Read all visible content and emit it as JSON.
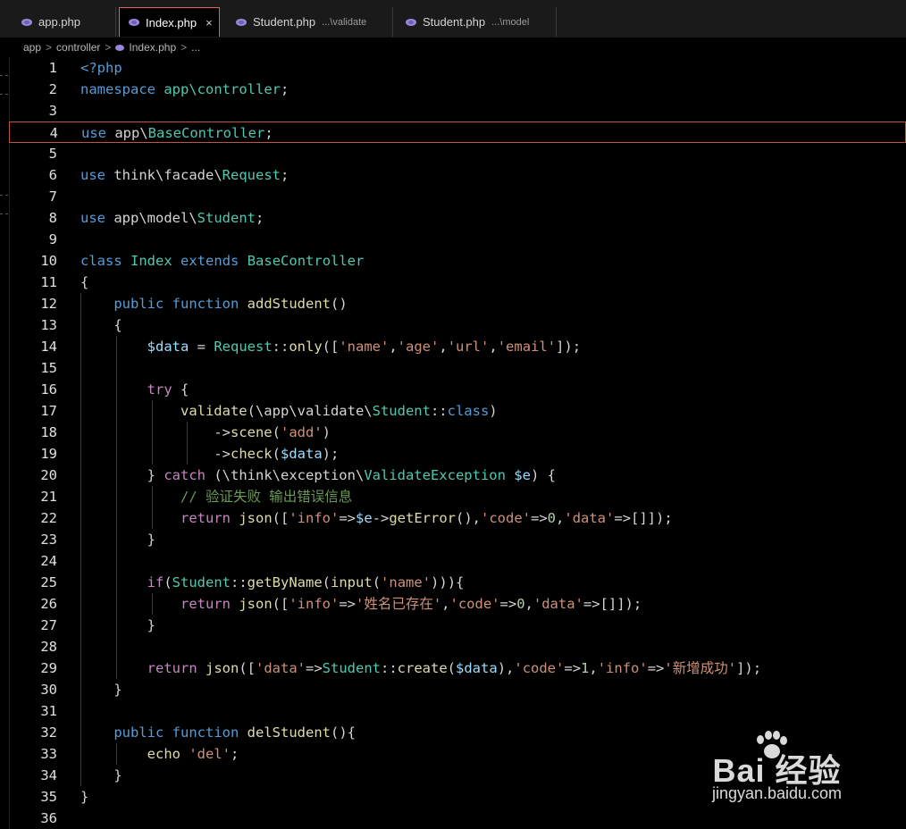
{
  "tabs": [
    {
      "label": "app.php",
      "desc": "",
      "active": false
    },
    {
      "label": "Index.php",
      "desc": "",
      "active": true
    },
    {
      "label": "Student.php",
      "desc": "...\\validate",
      "active": false
    },
    {
      "label": "Student.php",
      "desc": "...\\model",
      "active": false
    }
  ],
  "close_glyph": "×",
  "breadcrumb": {
    "items": [
      "app",
      "controller",
      "Index.php",
      "..."
    ],
    "separator": ">"
  },
  "editor": {
    "current_line": 4,
    "lines": [
      [
        [
          "kw",
          "<?php"
        ]
      ],
      [
        [
          "kw",
          "namespace"
        ],
        [
          "pl",
          " "
        ],
        [
          "cls",
          "app\\controller"
        ],
        [
          "pl",
          ";"
        ]
      ],
      [],
      [
        [
          "kw",
          "use"
        ],
        [
          "pl",
          " app\\"
        ],
        [
          "cls",
          "BaseController"
        ],
        [
          "pl",
          ";"
        ]
      ],
      [],
      [
        [
          "kw",
          "use"
        ],
        [
          "pl",
          " think\\facade\\"
        ],
        [
          "cls",
          "Request"
        ],
        [
          "pl",
          ";"
        ]
      ],
      [],
      [
        [
          "kw",
          "use"
        ],
        [
          "pl",
          " app\\model\\"
        ],
        [
          "cls",
          "Student"
        ],
        [
          "pl",
          ";"
        ]
      ],
      [],
      [
        [
          "kw",
          "class"
        ],
        [
          "pl",
          " "
        ],
        [
          "cls",
          "Index"
        ],
        [
          "pl",
          " "
        ],
        [
          "kw",
          "extends"
        ],
        [
          "pl",
          " "
        ],
        [
          "cls",
          "BaseController"
        ]
      ],
      [
        [
          "pl",
          "{"
        ]
      ],
      [
        [
          "pl",
          "    "
        ],
        [
          "kw",
          "public"
        ],
        [
          "pl",
          " "
        ],
        [
          "kw",
          "function"
        ],
        [
          "pl",
          " "
        ],
        [
          "fn",
          "addStudent"
        ],
        [
          "pl",
          "()"
        ]
      ],
      [
        [
          "pl",
          "    {"
        ]
      ],
      [
        [
          "pl",
          "        "
        ],
        [
          "var",
          "$data"
        ],
        [
          "pl",
          " = "
        ],
        [
          "cls",
          "Request"
        ],
        [
          "pl",
          "::"
        ],
        [
          "fn",
          "only"
        ],
        [
          "pl",
          "(["
        ],
        [
          "str",
          "'name'"
        ],
        [
          "pl",
          ","
        ],
        [
          "str",
          "'age'"
        ],
        [
          "pl",
          ","
        ],
        [
          "str",
          "'url'"
        ],
        [
          "pl",
          ","
        ],
        [
          "str",
          "'email'"
        ],
        [
          "pl",
          "]);"
        ]
      ],
      [],
      [
        [
          "pl",
          "        "
        ],
        [
          "ctl",
          "try"
        ],
        [
          "pl",
          " {"
        ]
      ],
      [
        [
          "pl",
          "            "
        ],
        [
          "fn",
          "validate"
        ],
        [
          "pl",
          "(\\app\\validate\\"
        ],
        [
          "cls",
          "Student"
        ],
        [
          "pl",
          "::"
        ],
        [
          "kw",
          "class"
        ],
        [
          "pl",
          ")"
        ]
      ],
      [
        [
          "pl",
          "                ->"
        ],
        [
          "fn",
          "scene"
        ],
        [
          "pl",
          "("
        ],
        [
          "str",
          "'add'"
        ],
        [
          "pl",
          ")"
        ]
      ],
      [
        [
          "pl",
          "                ->"
        ],
        [
          "fn",
          "check"
        ],
        [
          "pl",
          "("
        ],
        [
          "var",
          "$data"
        ],
        [
          "pl",
          ");"
        ]
      ],
      [
        [
          "pl",
          "        } "
        ],
        [
          "ctl",
          "catch"
        ],
        [
          "pl",
          " (\\think\\exception\\"
        ],
        [
          "cls",
          "ValidateException"
        ],
        [
          "pl",
          " "
        ],
        [
          "var",
          "$e"
        ],
        [
          "pl",
          ") {"
        ]
      ],
      [
        [
          "pl",
          "            "
        ],
        [
          "cmt",
          "// 验证失败 输出错误信息"
        ]
      ],
      [
        [
          "pl",
          "            "
        ],
        [
          "ctl",
          "return"
        ],
        [
          "pl",
          " "
        ],
        [
          "fn",
          "json"
        ],
        [
          "pl",
          "(["
        ],
        [
          "str",
          "'info'"
        ],
        [
          "pl",
          "=>"
        ],
        [
          "var",
          "$e"
        ],
        [
          "pl",
          "->"
        ],
        [
          "fn",
          "getError"
        ],
        [
          "pl",
          "(),"
        ],
        [
          "str",
          "'code'"
        ],
        [
          "pl",
          "=>"
        ],
        [
          "num",
          "0"
        ],
        [
          "pl",
          ","
        ],
        [
          "str",
          "'data'"
        ],
        [
          "pl",
          "=>[]]);"
        ]
      ],
      [
        [
          "pl",
          "        }"
        ]
      ],
      [],
      [
        [
          "pl",
          "        "
        ],
        [
          "ctl",
          "if"
        ],
        [
          "pl",
          "("
        ],
        [
          "cls",
          "Student"
        ],
        [
          "pl",
          "::"
        ],
        [
          "fn",
          "getByName"
        ],
        [
          "pl",
          "("
        ],
        [
          "fn",
          "input"
        ],
        [
          "pl",
          "("
        ],
        [
          "str",
          "'name'"
        ],
        [
          "pl",
          ")))"
        ],
        [
          "pl",
          "{"
        ]
      ],
      [
        [
          "pl",
          "            "
        ],
        [
          "ctl",
          "return"
        ],
        [
          "pl",
          " "
        ],
        [
          "fn",
          "json"
        ],
        [
          "pl",
          "(["
        ],
        [
          "str",
          "'info'"
        ],
        [
          "pl",
          "=>"
        ],
        [
          "str",
          "'姓名已存在'"
        ],
        [
          "pl",
          ","
        ],
        [
          "str",
          "'code'"
        ],
        [
          "pl",
          "=>"
        ],
        [
          "num",
          "0"
        ],
        [
          "pl",
          ","
        ],
        [
          "str",
          "'data'"
        ],
        [
          "pl",
          "=>[]]);"
        ]
      ],
      [
        [
          "pl",
          "        }"
        ]
      ],
      [],
      [
        [
          "pl",
          "        "
        ],
        [
          "ctl",
          "return"
        ],
        [
          "pl",
          " "
        ],
        [
          "fn",
          "json"
        ],
        [
          "pl",
          "(["
        ],
        [
          "str",
          "'data'"
        ],
        [
          "pl",
          "=>"
        ],
        [
          "cls",
          "Student"
        ],
        [
          "pl",
          "::"
        ],
        [
          "fn",
          "create"
        ],
        [
          "pl",
          "("
        ],
        [
          "var",
          "$data"
        ],
        [
          "pl",
          "),"
        ],
        [
          "str",
          "'code'"
        ],
        [
          "pl",
          "=>"
        ],
        [
          "num",
          "1"
        ],
        [
          "pl",
          ","
        ],
        [
          "str",
          "'info'"
        ],
        [
          "pl",
          "=>"
        ],
        [
          "str",
          "'新增成功'"
        ],
        [
          "pl",
          "]);"
        ]
      ],
      [
        [
          "pl",
          "    }"
        ]
      ],
      [],
      [
        [
          "pl",
          "    "
        ],
        [
          "kw",
          "public"
        ],
        [
          "pl",
          " "
        ],
        [
          "kw",
          "function"
        ],
        [
          "pl",
          " "
        ],
        [
          "fn",
          "delStudent"
        ],
        [
          "pl",
          "(){"
        ]
      ],
      [
        [
          "pl",
          "        "
        ],
        [
          "fn",
          "echo"
        ],
        [
          "pl",
          " "
        ],
        [
          "str",
          "'del'"
        ],
        [
          "pl",
          ";"
        ]
      ],
      [
        [
          "pl",
          "    }"
        ]
      ],
      [
        [
          "pl",
          "}"
        ]
      ],
      []
    ]
  },
  "watermark": {
    "logo_text": "Bai  经验",
    "domain": "jingyan.baidu.com"
  },
  "colors": {
    "keyword": "#569cd6",
    "control": "#c586c0",
    "class": "#4ec9b0",
    "string": "#ce9178",
    "variable": "#9cdcfe",
    "function": "#dcdcaa",
    "number": "#b5cea8",
    "comment": "#6a9955",
    "active_tab_border": "#e85e5e"
  }
}
